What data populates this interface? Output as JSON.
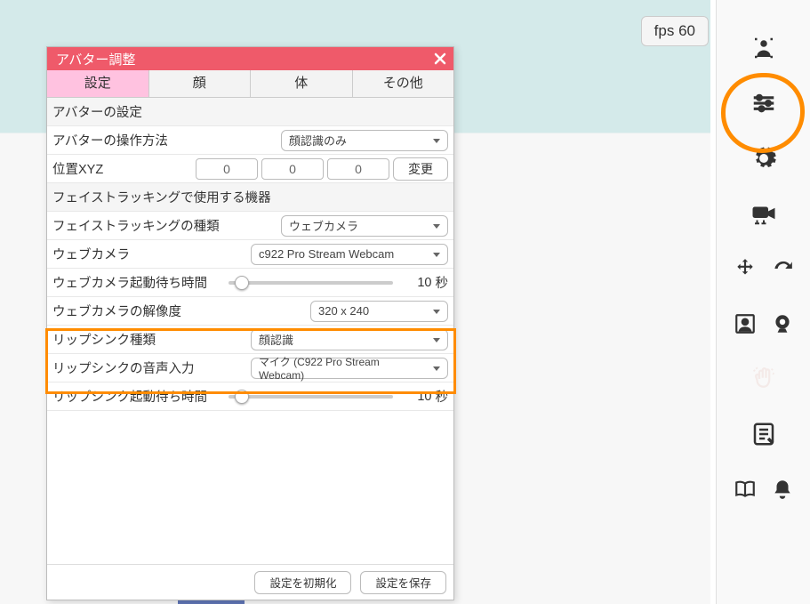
{
  "fps_label": "fps",
  "fps_value": "60",
  "panel": {
    "title": "アバター調整",
    "tabs": [
      "設定",
      "顔",
      "体",
      "その他"
    ],
    "active_tab": 0,
    "sections": {
      "avatar_settings_head": "アバターの設定",
      "control_method_label": "アバターの操作方法",
      "control_method_value": "顔認識のみ",
      "position_label": "位置XYZ",
      "position_x": "0",
      "position_y": "0",
      "position_z": "0",
      "change_btn": "変更",
      "facetrack_head": "フェイストラッキングで使用する機器",
      "facetrack_type_label": "フェイストラッキングの種類",
      "facetrack_type_value": "ウェブカメラ",
      "webcam_label": "ウェブカメラ",
      "webcam_value": "c922 Pro Stream Webcam",
      "webcam_wait_label": "ウェブカメラ起動待ち時間",
      "webcam_wait_value": "10",
      "seconds": "秒",
      "webcam_res_label": "ウェブカメラの解像度",
      "webcam_res_value": "320 x 240",
      "lipsync_type_label": "リップシンク種類",
      "lipsync_type_value": "顔認識",
      "lipsync_audio_label": "リップシンクの音声入力",
      "lipsync_audio_value": "マイク (C922 Pro Stream Webcam)",
      "lipsync_wait_label": "リップシンク起動待ち時間",
      "lipsync_wait_value": "10"
    },
    "footer": {
      "reset": "設定を初期化",
      "save": "設定を保存"
    }
  },
  "sidebar": {
    "icons": [
      "avatar-icon",
      "sliders-icon",
      "gear-icon",
      "camera-icon",
      "move-icon",
      "redo-icon",
      "portrait-icon",
      "webcam-icon",
      "hand-icon",
      "note-icon",
      "book-icon",
      "bell-icon"
    ]
  }
}
